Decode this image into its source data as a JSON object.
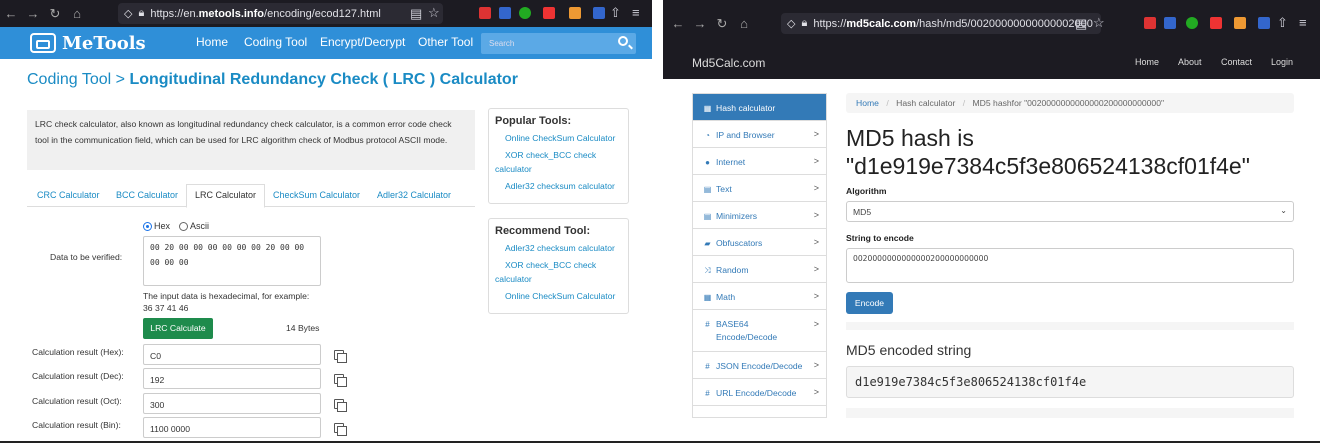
{
  "left": {
    "browser": {
      "url_prefix": "https://en.",
      "url_domain": "metools.info",
      "url_path": "/encoding/ecod127.html"
    },
    "site": {
      "logo": "MeTools",
      "nav": [
        "Home",
        "Coding Tool",
        "Encrypt/Decrypt",
        "Other Tool"
      ],
      "search_placeholder": "Search"
    },
    "title_prefix": "Coding Tool > ",
    "title_main": "Longitudinal Redundancy Check ( LRC ) Calculator",
    "description": "LRC check calculator, also known as longitudinal redundancy check calculator, is a common error code check tool in the communication field, which can be used for LRC algorithm check of Modbus protocol ASCII mode.",
    "tabs": [
      "CRC Calculator",
      "BCC Calculator",
      "LRC Calculator",
      "CheckSum Calculator",
      "Adler32 Calculator"
    ],
    "active_tab": "LRC Calculator",
    "radio_hex": "Hex",
    "radio_ascii": "Ascii",
    "data_label": "Data to be verified:",
    "data_value": "00 20 00 00 00 00 00 00 20 00 00 00 00 00",
    "hint_line1": "The input data is hexadecimal, for example:",
    "hint_line2": "36 37 41 46",
    "calc_button": "LRC Calculate",
    "bytes": "14 Bytes",
    "results": [
      {
        "label": "Calculation result (Hex):",
        "value": "C0"
      },
      {
        "label": "Calculation result (Dec):",
        "value": "192"
      },
      {
        "label": "Calculation result (Oct):",
        "value": "300"
      },
      {
        "label": "Calculation result (Bin):",
        "value": "1100 0000"
      }
    ],
    "popular_title": "Popular Tools:",
    "popular": [
      "Online CheckSum Calculator",
      "XOR check_BCC check calculator",
      "Adler32 checksum calculator"
    ],
    "recommend_title": "Recommend Tool:",
    "recommend": [
      "Adler32 checksum calculator",
      "XOR check_BCC check calculator",
      "Online CheckSum Calculator"
    ]
  },
  "right": {
    "browser": {
      "url_prefix": "https://",
      "url_domain": "md5calc.com",
      "url_path": "/hash/md5/00200000000000002000"
    },
    "brand": "Md5Calc.com",
    "nav": [
      "Home",
      "About",
      "Contact",
      "Login"
    ],
    "sidebar": [
      {
        "label": "Hash calculator",
        "icon": "grid-icon",
        "glyph": "▦",
        "active": true
      },
      {
        "label": "IP and Browser",
        "icon": "wifi-icon",
        "glyph": "◔"
      },
      {
        "label": "Internet",
        "icon": "globe-icon",
        "glyph": "●"
      },
      {
        "label": "Text",
        "icon": "file-icon",
        "glyph": "▤"
      },
      {
        "label": "Minimizers",
        "icon": "file-icon",
        "glyph": "▤"
      },
      {
        "label": "Obfuscators",
        "icon": "lock-icon",
        "glyph": "▰"
      },
      {
        "label": "Random",
        "icon": "shuffle-icon",
        "glyph": "⤨"
      },
      {
        "label": "Math",
        "icon": "calculator-icon",
        "glyph": "▦"
      },
      {
        "label": "BASE64 Encode/Decode",
        "icon": "hash-icon",
        "glyph": "#"
      },
      {
        "label": "JSON Encode/Decode",
        "icon": "hash-icon",
        "glyph": "#"
      },
      {
        "label": "URL Encode/Decode",
        "icon": "hash-icon",
        "glyph": "#"
      }
    ],
    "breadcrumb": [
      "Home",
      "Hash calculator",
      "MD5 hashfor \"0020000000000000200000000000\""
    ],
    "heading_line1": "MD5 hash is",
    "heading_line2": "\"d1e919e7384c5f3e806524138cf01f4e\"",
    "algorithm_label": "Algorithm",
    "algorithm_value": "MD5",
    "string_label": "String to encode",
    "string_value": "0020000000000000200000000000",
    "encode_button": "Encode",
    "encoded_heading": "MD5 encoded string",
    "encoded_value": "d1e919e7384c5f3e806524138cf01f4e"
  }
}
